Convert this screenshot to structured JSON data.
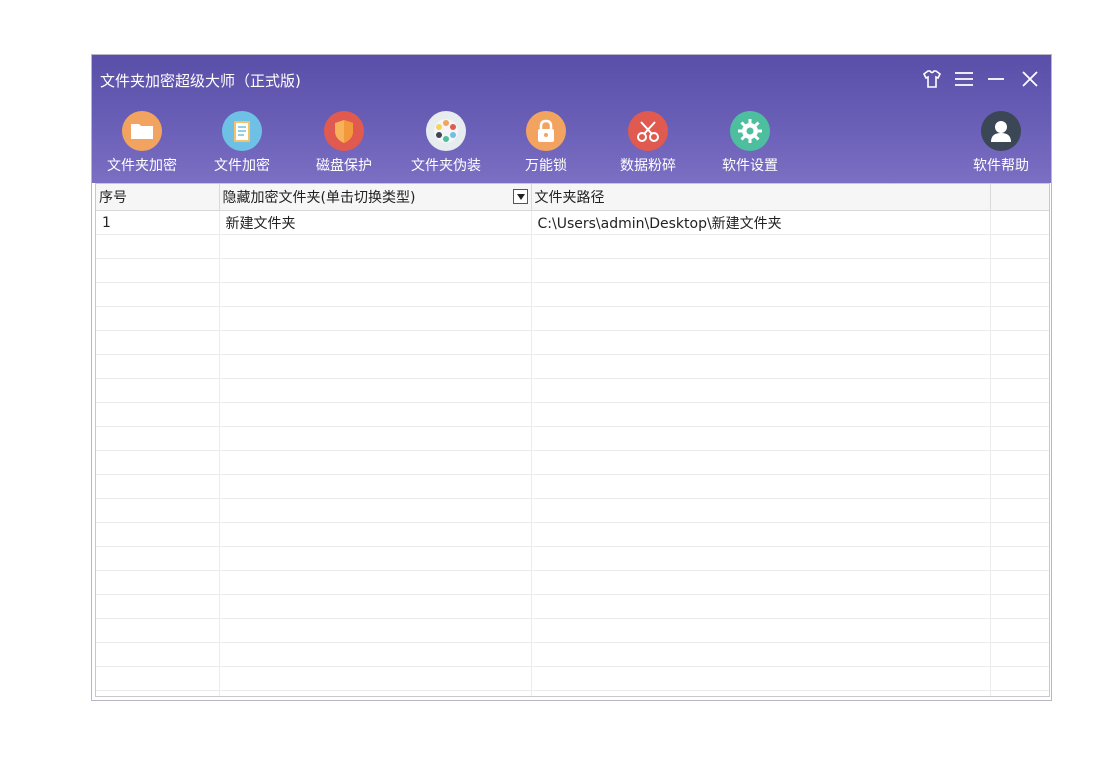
{
  "window": {
    "title": "文件夹加密超级大师（正式版)"
  },
  "toolbar": [
    {
      "label": "文件夹加密",
      "icon": "folder-icon",
      "color": "#f2a35f"
    },
    {
      "label": "文件加密",
      "icon": "document-icon",
      "color": "#6ec1e4"
    },
    {
      "label": "磁盘保护",
      "icon": "shield-icon",
      "color": "#e05a4f"
    },
    {
      "label": "文件夹伪装",
      "icon": "palette-icon",
      "color": "#e7ecef"
    },
    {
      "label": "万能锁",
      "icon": "lock-icon",
      "color": "#f2a35f"
    },
    {
      "label": "数据粉碎",
      "icon": "scissors-icon",
      "color": "#e05a4f"
    },
    {
      "label": "软件设置",
      "icon": "gear-icon",
      "color": "#4dbf9f"
    },
    {
      "label": "软件帮助",
      "icon": "user-icon",
      "color": "#3c4756"
    }
  ],
  "table": {
    "headers": [
      "序号",
      "隐藏加密文件夹(单击切换类型)",
      "文件夹路径",
      ""
    ],
    "rows": [
      [
        "1",
        "新建文件夹",
        "C:\\Users\\admin\\Desktop\\新建文件夹",
        ""
      ]
    ]
  }
}
